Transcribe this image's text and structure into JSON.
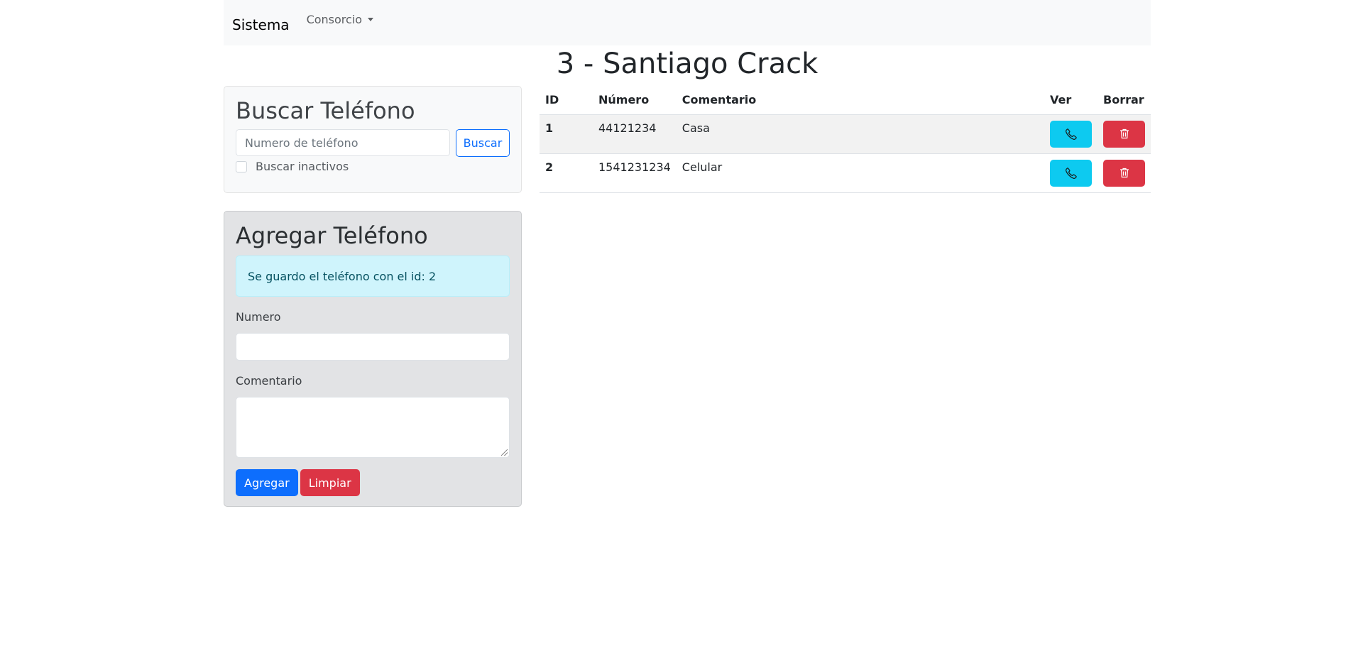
{
  "navbar": {
    "brand": "Sistema",
    "menu_label": "Consorcio"
  },
  "page_title": "3 - Santiago Crack",
  "search": {
    "title": "Buscar Teléfono",
    "placeholder": "Numero de teléfono",
    "button": "Buscar",
    "inactive_label": "Buscar inactivos"
  },
  "add": {
    "title": "Agregar Teléfono",
    "alert": "Se guardo el teléfono con el id: 2",
    "numero_label": "Numero",
    "comentario_label": "Comentario",
    "agregar_button": "Agregar",
    "limpiar_button": "Limpiar"
  },
  "table": {
    "headers": {
      "id": "ID",
      "numero": "Número",
      "comentario": "Comentario",
      "ver": "Ver",
      "borrar": "Borrar"
    },
    "rows": [
      {
        "id": "1",
        "numero": "44121234",
        "comentario": "Casa"
      },
      {
        "id": "2",
        "numero": "1541231234",
        "comentario": "Celular"
      }
    ]
  },
  "icons": {
    "ver": "phone-icon",
    "borrar": "trash-icon"
  },
  "colors": {
    "primary": "#0d6efd",
    "info": "#0dcaf0",
    "danger": "#dc3545",
    "alert_bg": "#cff4fc"
  }
}
